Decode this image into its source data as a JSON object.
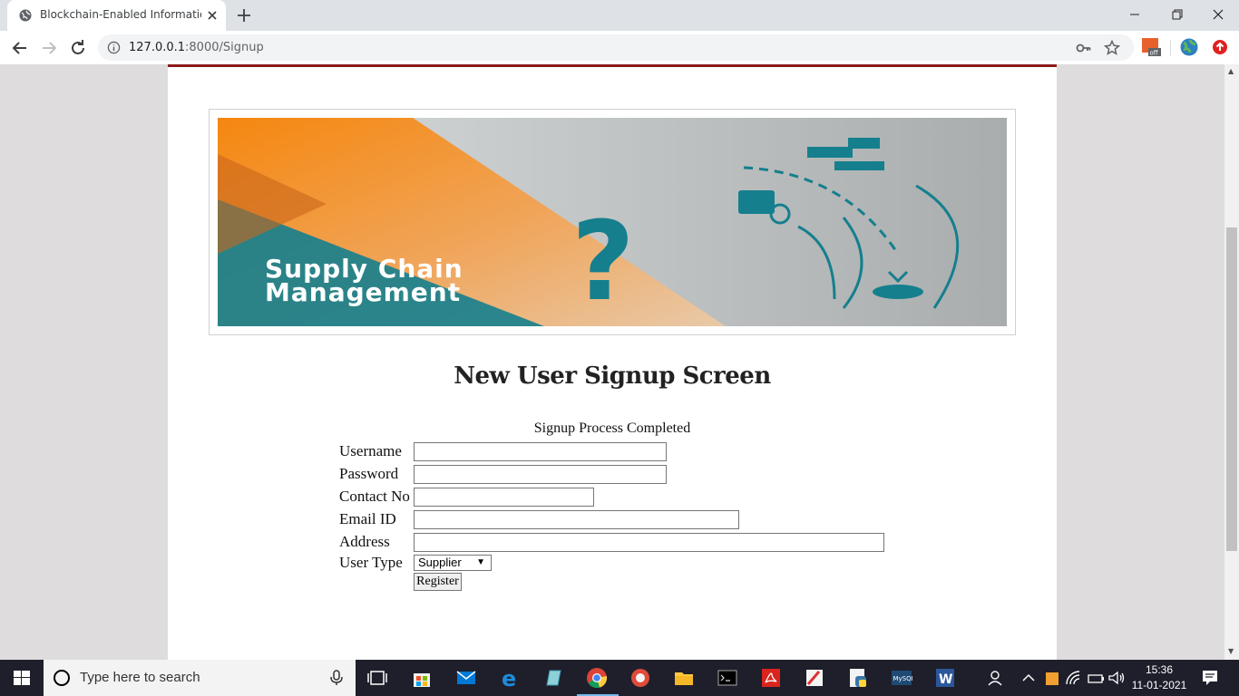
{
  "browser": {
    "tab_title": "Blockchain-Enabled Information",
    "url_host": "127.0.0.1",
    "url_path": ":8000/Signup"
  },
  "page": {
    "banner": {
      "line1": "Supply Chain",
      "line2": "Management",
      "question": "?"
    },
    "heading": "New User Signup Screen",
    "status": "Signup Process Completed",
    "form": {
      "username_label": "Username",
      "password_label": "Password",
      "contact_label": "Contact No",
      "email_label": "Email ID",
      "address_label": "Address",
      "user_type_label": "User Type",
      "user_type_value": "Supplier",
      "register_label": "Register"
    }
  },
  "taskbar": {
    "search_placeholder": "Type here to search",
    "time": "15:36",
    "date": "11-01-2021"
  },
  "colors": {
    "page_top_border": "#8b1a1a",
    "banner_orange": "#f08a1c",
    "banner_teal": "#157f8e",
    "taskbar": "#1e1f2b"
  }
}
